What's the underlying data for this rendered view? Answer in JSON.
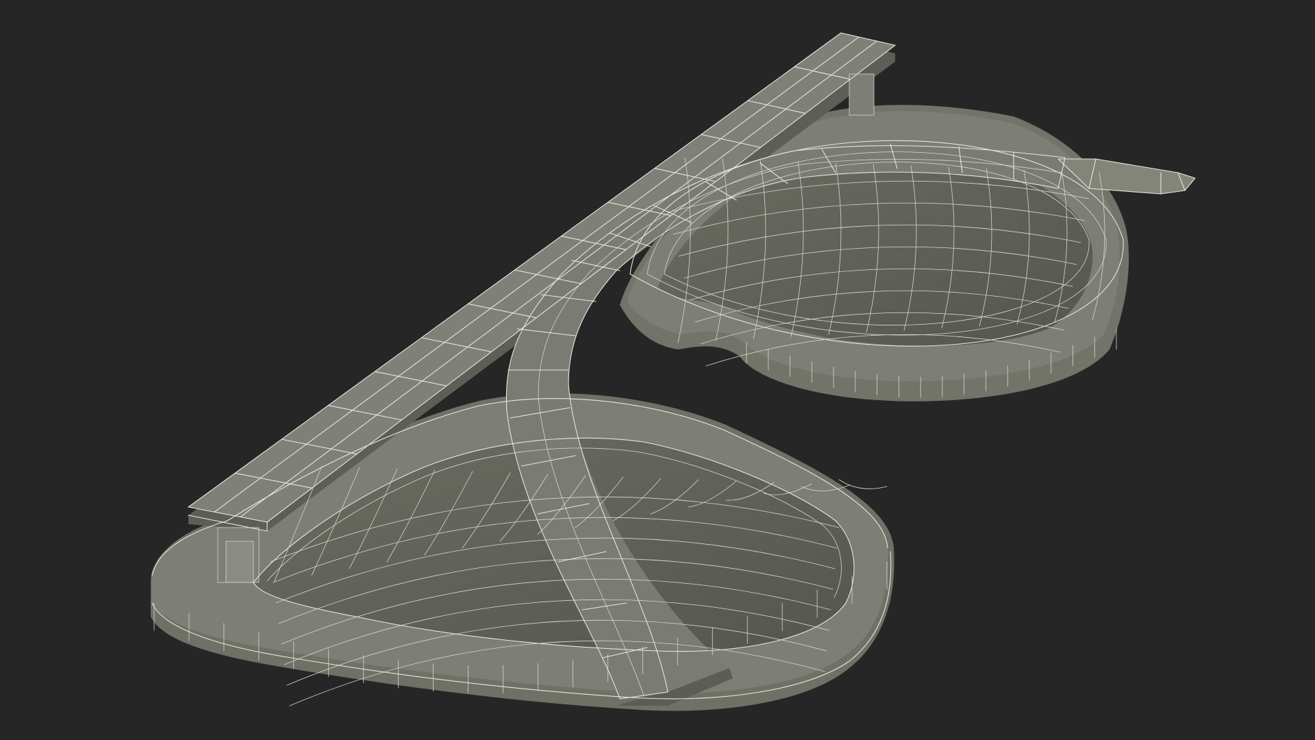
{
  "scene": {
    "background_color": "#262626",
    "object_fill": "#6f7066",
    "object_fill_dark": "#5b5c53",
    "object_fill_shadow": "#4e4f47",
    "wireframe_color": "#e8e8e0"
  }
}
